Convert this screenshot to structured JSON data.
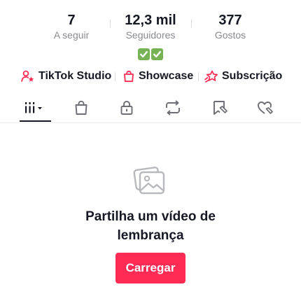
{
  "stats": {
    "following": {
      "value": "7",
      "label": "A seguir"
    },
    "followers": {
      "value": "12,3 mil",
      "label": "Seguidores"
    },
    "likes": {
      "value": "377",
      "label": "Gostos"
    }
  },
  "bio_emoji": "✅✅",
  "links": {
    "studio": "TikTok Studio",
    "showcase": "Showcase",
    "subscription": "Subscrição"
  },
  "tabs": [
    {
      "icon": "videos-grid-icon",
      "active": true
    },
    {
      "icon": "shopping-bag-icon",
      "active": false
    },
    {
      "icon": "lock-icon",
      "active": false
    },
    {
      "icon": "repost-icon",
      "active": false
    },
    {
      "icon": "bookmark-icon",
      "active": false
    },
    {
      "icon": "liked-heart-icon",
      "active": false
    }
  ],
  "empty_state": {
    "icon": "photo-stack-icon",
    "title_line1": "Partilha um vídeo de",
    "title_line2": "lembrança",
    "button_label": "Carregar"
  },
  "colors": {
    "accent": "#fe2c55",
    "text": "#161823",
    "muted": "#8a8b91",
    "check_green": "#77b255"
  }
}
